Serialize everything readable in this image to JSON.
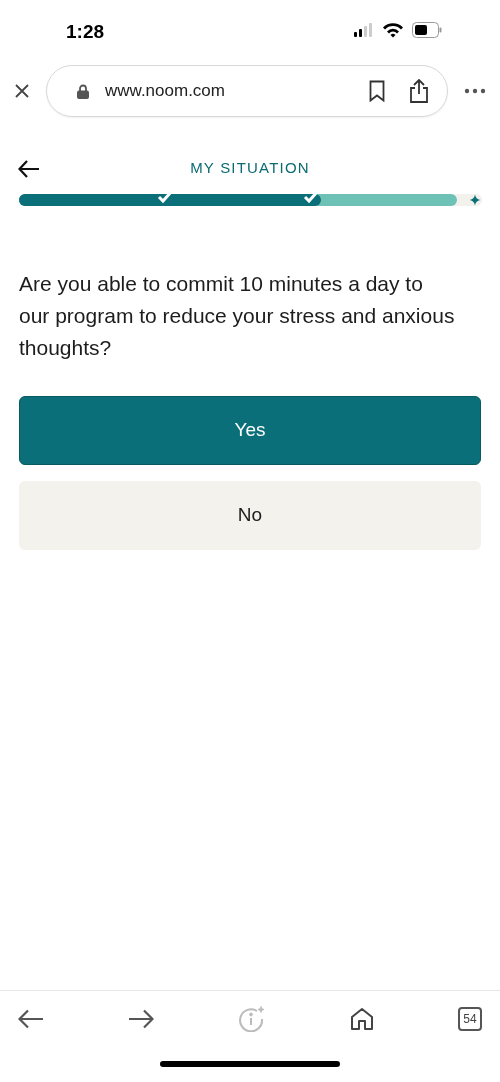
{
  "status_bar": {
    "time": "1:28"
  },
  "browser": {
    "url": "www.noom.com"
  },
  "header": {
    "title": "MY SITUATION"
  },
  "progress": {
    "level": 0.69,
    "steps": [
      {
        "completed": true
      },
      {
        "completed": true
      }
    ]
  },
  "question": "Are you able to commit 10 minutes a day to our program to reduce your stress and anxious thoughts?",
  "answers": [
    {
      "label": "Yes",
      "selected": true
    },
    {
      "label": "No",
      "selected": false
    }
  ],
  "toolbar": {
    "tab_count": "54",
    "info_disabled": true
  }
}
